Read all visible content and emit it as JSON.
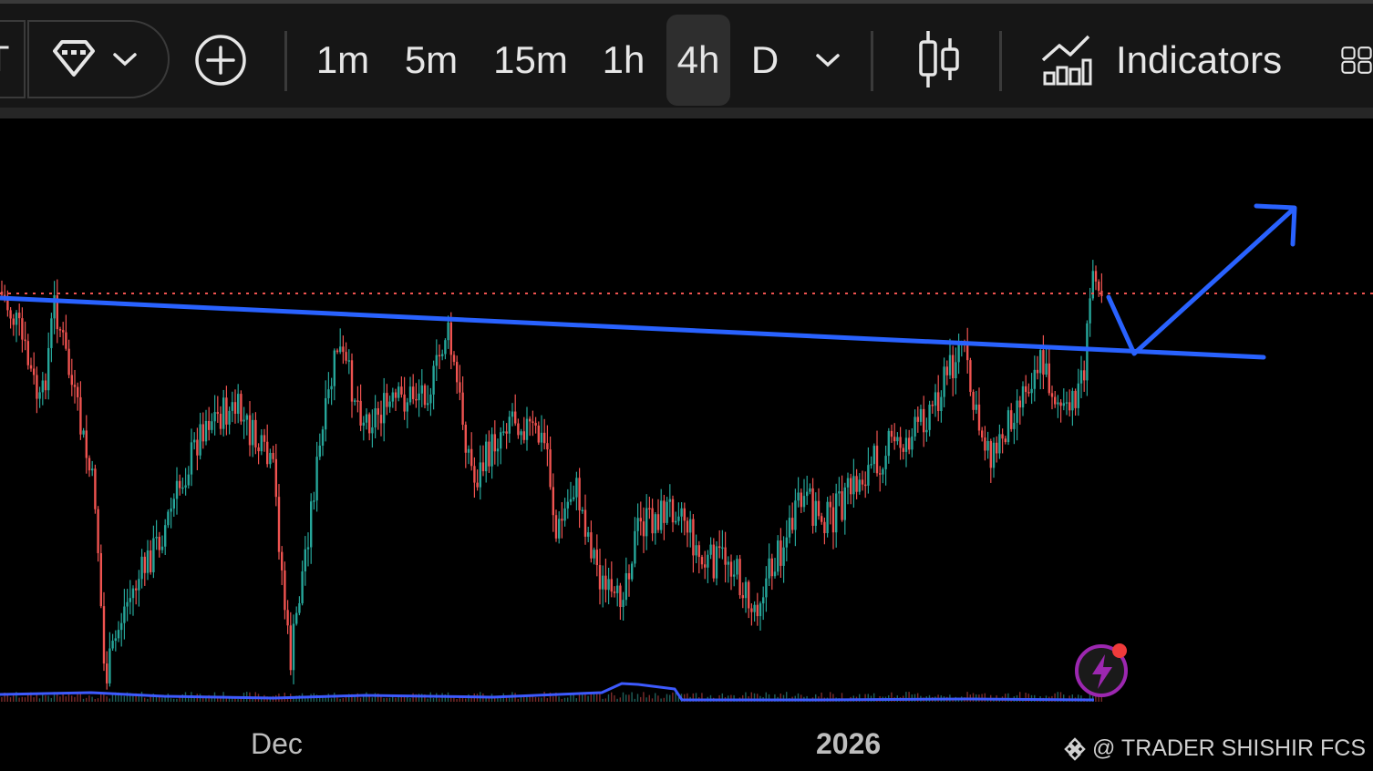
{
  "toolbar": {
    "symbol_partial": "T",
    "add_label": "+",
    "timeframes": [
      {
        "label": "1m",
        "active": false
      },
      {
        "label": "5m",
        "active": false
      },
      {
        "label": "15m",
        "active": false
      },
      {
        "label": "1h",
        "active": false
      },
      {
        "label": "4h",
        "active": true
      },
      {
        "label": "D",
        "active": false
      }
    ],
    "indicators_label": "Indicators",
    "icons": [
      "pro-diamond-icon",
      "chevron-down-icon",
      "add-circle-icon",
      "chevron-down-icon",
      "candlestick-icon",
      "indicators-chart-icon",
      "layout-grid-icon"
    ]
  },
  "chart": {
    "x_axis_labels": [
      "Dec",
      "2026"
    ],
    "watermark": "@ TRADER SHISHIR FCS",
    "colors": {
      "up": "#26a69a",
      "down": "#ef5350",
      "trendline": "#2962ff",
      "price_line": "#ef5350",
      "volume_line": "#3d5afe",
      "background": "#000000",
      "lightning": "#9c27b0"
    },
    "icons": [
      "lightning-alert-icon",
      "binance-logo-icon"
    ]
  }
}
